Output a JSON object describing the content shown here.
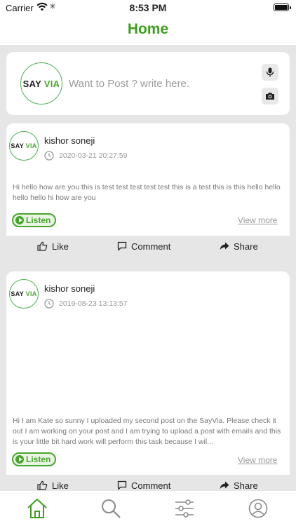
{
  "status_bar": {
    "carrier": "Carrier",
    "time": "8:53 PM"
  },
  "header": {
    "title": "Home"
  },
  "composer": {
    "logo_say": "SAY",
    "logo_via": "VIA",
    "placeholder": "Want to Post ? write here.",
    "mic_icon": "microphone-icon",
    "camera_icon": "camera-icon"
  },
  "posts": [
    {
      "logo_say": "SAY",
      "logo_via": "VIA",
      "author": "kishor soneji",
      "date": "2020-03-21 20:27:59",
      "text": "Hi hello how are you this is test test test test test this is a test this is this hello hello hello hello hi how are you",
      "listen_label": "Listen",
      "view_more_label": "View more",
      "actions": {
        "like": "Like",
        "comment": "Comment",
        "share": "Share"
      }
    },
    {
      "logo_say": "SAY",
      "logo_via": "VIA",
      "author": "kishor soneji",
      "date": "2019-08-23 13:13:57",
      "text": "Hi I am Kate so sunny I uploaded my second post on the SayVia. Please check it out I am working on your post and I am trying to upload a post with emails and this is your little bit hard work will perform this task because I wil...",
      "listen_label": "Listen",
      "view_more_label": "View more",
      "actions": {
        "like": "Like",
        "comment": "Comment",
        "share": "Share"
      }
    }
  ],
  "tab_bar": {
    "items": [
      {
        "icon": "home-icon",
        "active": true
      },
      {
        "icon": "search-icon",
        "active": false
      },
      {
        "icon": "filter-icon",
        "active": false
      },
      {
        "icon": "profile-icon",
        "active": false
      }
    ]
  },
  "colors": {
    "brand_green": "#3f9e1e",
    "background": "#e6e6e6",
    "card": "#ffffff"
  }
}
